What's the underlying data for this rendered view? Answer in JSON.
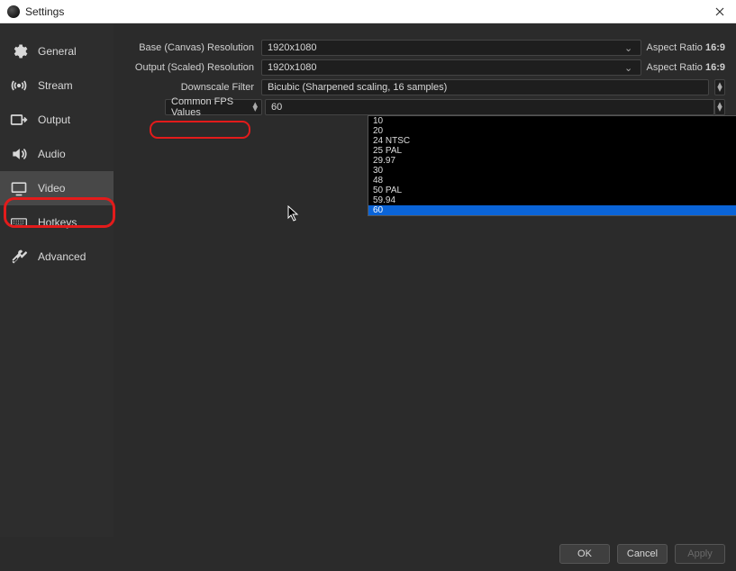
{
  "window": {
    "title": "Settings",
    "close": "✕"
  },
  "sidebar": {
    "items": [
      {
        "label": "General"
      },
      {
        "label": "Stream"
      },
      {
        "label": "Output"
      },
      {
        "label": "Audio"
      },
      {
        "label": "Video"
      },
      {
        "label": "Hotkeys"
      },
      {
        "label": "Advanced"
      }
    ]
  },
  "video": {
    "base_label": "Base (Canvas) Resolution",
    "base_value": "1920x1080",
    "output_label": "Output (Scaled) Resolution",
    "output_value": "1920x1080",
    "filter_label": "Downscale Filter",
    "filter_value": "Bicubic (Sharpened scaling, 16 samples)",
    "aspect_prefix": "Aspect Ratio ",
    "aspect_value": "16:9",
    "fps_type_label": "Common FPS Values",
    "fps_value": "60",
    "fps_options": [
      "10",
      "20",
      "24 NTSC",
      "25 PAL",
      "29.97",
      "30",
      "48",
      "50 PAL",
      "59.94",
      "60"
    ]
  },
  "footer": {
    "ok": "OK",
    "cancel": "Cancel",
    "apply": "Apply"
  }
}
